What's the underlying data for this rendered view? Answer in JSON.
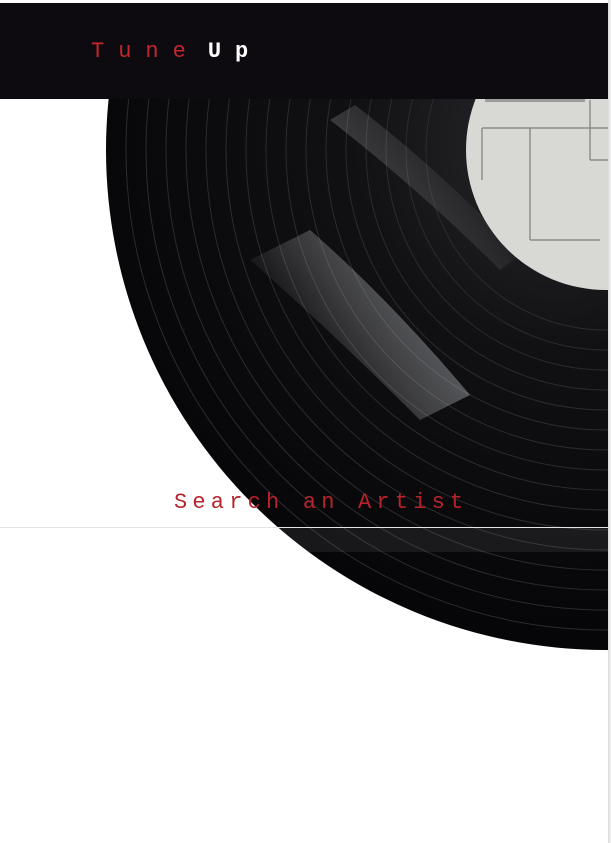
{
  "brand": {
    "word1": "Tune",
    "word2": "Up",
    "accent_color": "#c1272d",
    "secondary_color": "#ffffff"
  },
  "navbar": {
    "background": "#0e0b10"
  },
  "hero": {
    "image": "vinyl-record"
  },
  "search": {
    "label": "Search an Artist",
    "value": "",
    "placeholder": ""
  }
}
